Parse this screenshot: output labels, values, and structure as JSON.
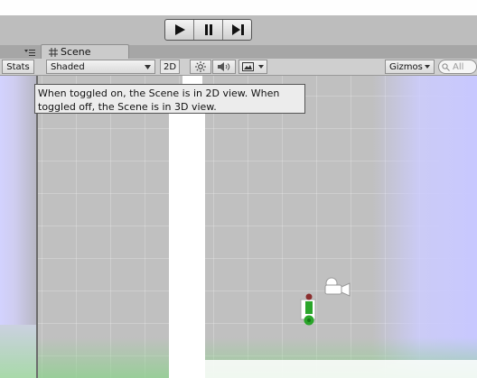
{
  "playbar": {
    "play": "play-icon",
    "pause": "pause-icon",
    "step": "step-icon"
  },
  "tabs": {
    "scene_label": "Scene",
    "menu_icon": "menu-icon"
  },
  "scene_toolbar": {
    "stats_label": "Stats",
    "draw_mode": "Shaded",
    "mode_2d_label": "2D",
    "lighting_icon": "sun-icon",
    "audio_icon": "speaker-icon",
    "effects_icon": "image-icon",
    "gizmos_label": "Gizmos",
    "search_placeholder": "All"
  },
  "tooltip": {
    "text": "When toggled on, the Scene is in 2D view. When toggled off, the Scene is in 3D view."
  },
  "colors": {
    "toolbar_bg": "#bdbdbd",
    "scene_bg": "#c0c0c0",
    "sprite_green": "#2aa52a",
    "tint_blue": "#c8c8ff",
    "tint_green": "#8cd28c"
  }
}
